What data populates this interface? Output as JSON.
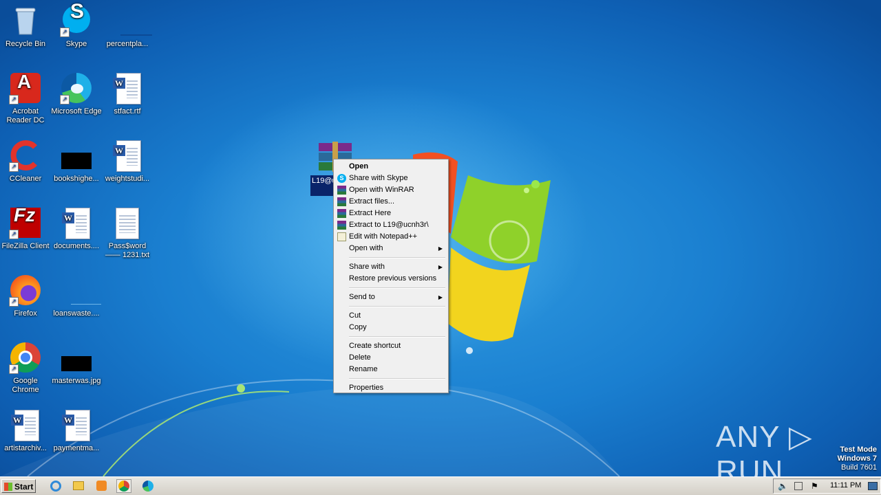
{
  "desktop_icons": [
    {
      "label": "Recycle Bin"
    },
    {
      "label": "Skype"
    },
    {
      "label": "percentpla..."
    },
    {
      "label": "Acrobat Reader DC"
    },
    {
      "label": "Microsoft Edge"
    },
    {
      "label": "stfact.rtf"
    },
    {
      "label": "CCleaner"
    },
    {
      "label": "bookshighe..."
    },
    {
      "label": "weightstudi..."
    },
    {
      "label": "FileZilla Client"
    },
    {
      "label": "documents...."
    },
    {
      "label": "Pass$word —— 1231.txt"
    },
    {
      "label": "Firefox"
    },
    {
      "label": "loanswaste...."
    },
    {
      "label": "Google Chrome"
    },
    {
      "label": "masterwas.jpg"
    },
    {
      "label": "artistarchiv..."
    },
    {
      "label": "paymentma..."
    }
  ],
  "selected_file": {
    "label": "L19@u"
  },
  "context_menu": {
    "items": [
      {
        "label": "Open"
      },
      {
        "label": "Share with Skype"
      },
      {
        "label": "Open with WinRAR"
      },
      {
        "label": "Extract files..."
      },
      {
        "label": "Extract Here"
      },
      {
        "label": "Extract to L19@ucnh3r\\"
      },
      {
        "label": "Edit with Notepad++"
      },
      {
        "label": "Open with"
      },
      {
        "label": "Share with"
      },
      {
        "label": "Restore previous versions"
      },
      {
        "label": "Send to"
      },
      {
        "label": "Cut"
      },
      {
        "label": "Copy"
      },
      {
        "label": "Create shortcut"
      },
      {
        "label": "Delete"
      },
      {
        "label": "Rename"
      },
      {
        "label": "Properties"
      }
    ]
  },
  "taskbar": {
    "start_label": "Start",
    "clock": "11:11 PM"
  },
  "watermark": {
    "text": "ANY ▷ RUN"
  },
  "test_mode": {
    "line1": "Test Mode",
    "line2": "Windows 7",
    "line3": "Build 7601"
  },
  "colors": {
    "selection": "#0a246a",
    "menu_bg": "#f0f0f0",
    "desktop_blue": "#1a7fd0"
  }
}
